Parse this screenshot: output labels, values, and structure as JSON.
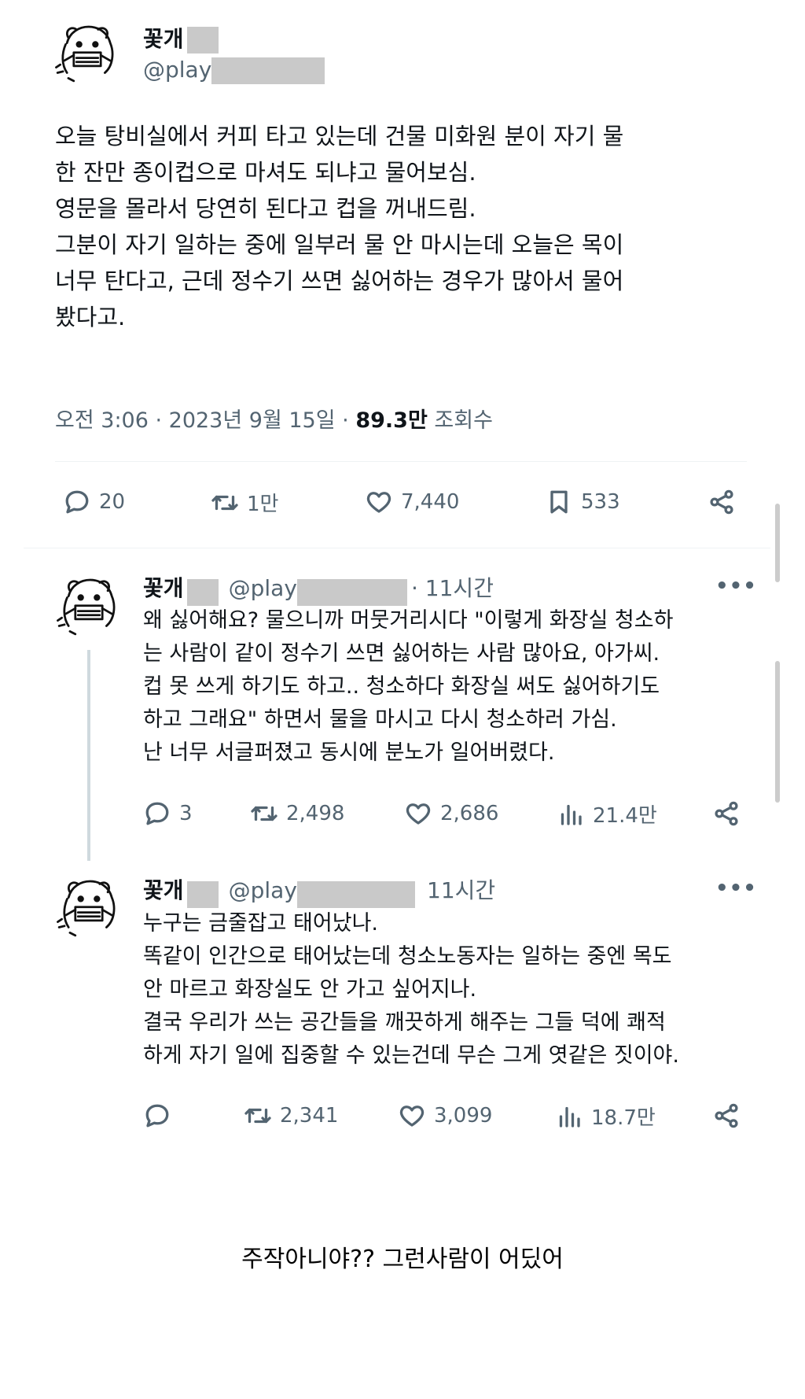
{
  "main_tweet": {
    "display_name": "꽃개",
    "handle": "@play",
    "text": "오늘 탕비실에서 커피 타고 있는데 건물 미화원 분이 자기 물\n한 잔만 종이컵으로 마셔도 되냐고 물어보심.\n영문을 몰라서 당연히 된다고 컵을 꺼내드림.\n그분이 자기 일하는 중에 일부러 물 안 마시는데 오늘은 목이\n너무 탄다고, 근데 정수기 쓰면 싫어하는 경우가 많아서 물어\n봤다고.",
    "time": "오전 3:06 · 2023년 9월 15일 ·",
    "views_value": "89.3만",
    "views_label": "조회수",
    "reply_count": "20",
    "retweet_count": "1만",
    "like_count": "7,440",
    "bookmark_count": "533"
  },
  "replies": [
    {
      "display_name": "꽃개",
      "handle": "@play",
      "time": "· 11시간",
      "more": "•••",
      "text": "왜 싫어해요? 물으니까 머뭇거리시다 \"이렇게 화장실 청소하\n는 사람이 같이 정수기 쓰면 싫어하는 사람 많아요, 아가씨.\n컵 못 쓰게 하기도 하고.. 청소하다 화장실 써도 싫어하기도\n하고 그래요\" 하면서 물을 마시고 다시 청소하러 가심.\n난 너무 서글퍼졌고 동시에 분노가 일어버렸다.",
      "reply_count": "3",
      "retweet_count": "2,498",
      "like_count": "2,686",
      "view_count": "21.4만"
    },
    {
      "display_name": "꽃개",
      "handle": "@play",
      "time": "11시간",
      "more": "•••",
      "text": "누구는 금줄잡고 태어났나.\n똑같이 인간으로 태어났는데 청소노동자는 일하는 중엔 목도\n안 마르고 화장실도 안 가고 싶어지나.\n결국 우리가 쓰는 공간들을 깨끗하게 해주는 그들 덕에 쾌적\n하게 자기 일에 집중할 수 있는건데 무슨 그게 엿같은 짓이야.",
      "reply_count": "",
      "retweet_count": "2,341",
      "like_count": "3,099",
      "view_count": "18.7만"
    }
  ],
  "caption": "주작아니야?? 그런사람이 어딨어",
  "icons": [
    "avatar-icon",
    "reply-icon",
    "retweet-icon",
    "like-icon",
    "bookmark-icon",
    "share-icon",
    "views-icon",
    "more-icon"
  ]
}
